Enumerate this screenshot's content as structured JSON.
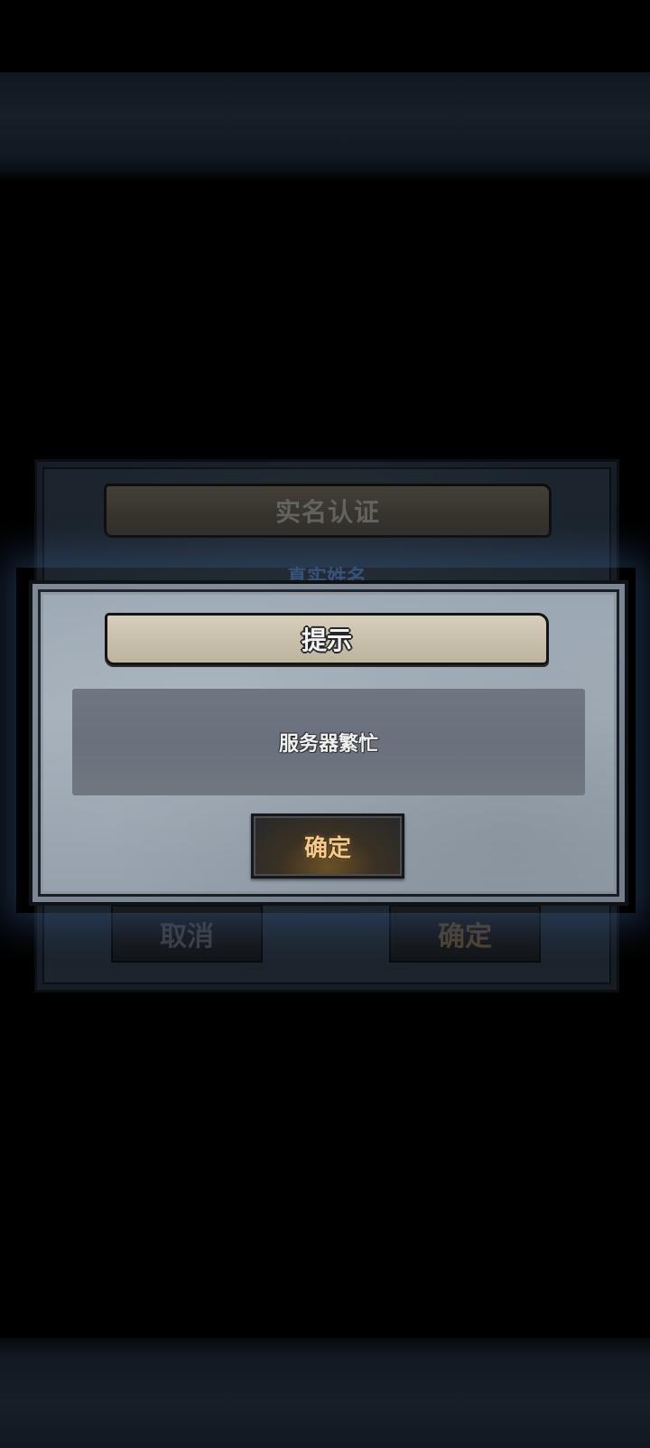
{
  "background_dialog": {
    "title": "实名认证",
    "field_label": "真实姓名",
    "cancel_label": "取消",
    "confirm_label": "确定"
  },
  "alert": {
    "title": "提示",
    "message": "服务器繁忙",
    "confirm_label": "确定"
  },
  "colors": {
    "accent_confirm_text": "#f5c98a",
    "dialog_panel": "#9aa6b2",
    "title_plate": "#cbc2ad",
    "glow": "#3a5c8c"
  }
}
